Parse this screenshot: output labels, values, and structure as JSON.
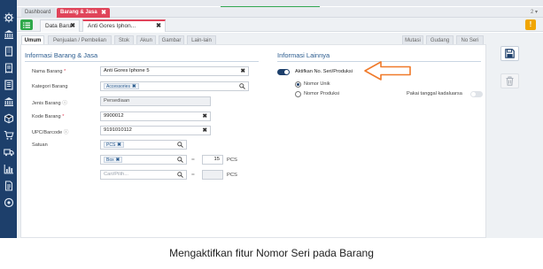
{
  "tabs_top": {
    "dashboard": "Dashboard",
    "barang_jasa": "Barang & Jasa",
    "close_glyph": "✖",
    "menu_right": "2 ▾"
  },
  "tabs_doc": {
    "data_baru": "Data Baru",
    "item": "Anti Gores Iphon...",
    "close_glyph": "✖",
    "warn_glyph": "!"
  },
  "sub_tabs": [
    {
      "label": "Umum",
      "active": true
    },
    {
      "label": "Penjualan / Pembelian",
      "active": false
    },
    {
      "label": "Stok",
      "active": false
    },
    {
      "label": "Akun",
      "active": false
    },
    {
      "label": "Gambar",
      "active": false
    },
    {
      "label": "Lain-lain",
      "active": false
    },
    {
      "label": "Mutasi",
      "active": false
    },
    {
      "label": "Gudang",
      "active": false
    },
    {
      "label": "No Seri",
      "active": false
    }
  ],
  "left": {
    "title": "Informasi Barang & Jasa",
    "fields": {
      "nama_label": "Nama Barang",
      "nama_value": "Anti Gores Iphone 5",
      "kategori_label": "Kategori Barang",
      "kategori_tag": "Accessories",
      "jenis_label": "Jenis Barang",
      "jenis_value": "Persediaan",
      "kode_label": "Kode Barang",
      "kode_value": "9900012",
      "upc_label": "UPC/Barcode",
      "upc_value": "9191010112",
      "satuan_label": "Satuan",
      "satuan_tag1": "PCS",
      "satuan_tag2": "Box",
      "satuan_placeholder": "Cari/Pilih...",
      "op_equals": "=",
      "conv_qty": "15",
      "conv_qty2": "",
      "unit1": "PCS",
      "unit2": "PCS",
      "required_mark": "*",
      "info_mark": "ⓘ",
      "clear_glyph": "✖"
    }
  },
  "right": {
    "title": "Informasi Lainnya",
    "serial_toggle_label": "Aktifkan No. Seri/Produksi",
    "serial_toggle_on": true,
    "radio_unique": "Nomor Unik",
    "radio_production": "Nomor Produksi",
    "selected_radio": "Nomor Unik",
    "expiry_label": "Pakai tanggal kadaluarsa",
    "expiry_toggle_on": false
  },
  "icons": {
    "nav": [
      "gear-icon",
      "bank-icon",
      "building-icon",
      "receipt-icon",
      "list-icon",
      "bank-icon",
      "box-icon",
      "cart-icon",
      "truck-icon",
      "chart-icon",
      "document-icon",
      "settings-icon"
    ],
    "save": "floppy-disk-icon",
    "delete": "trash-icon"
  },
  "colors": {
    "sidebar": "#1d3f6b",
    "accent_red": "#e0445a",
    "accent_green": "#2ea84a",
    "annotation_arrow": "#f07a2a",
    "section_title": "#2b5c8f"
  },
  "caption": "Mengaktifkan fitur Nomor Seri pada Barang"
}
